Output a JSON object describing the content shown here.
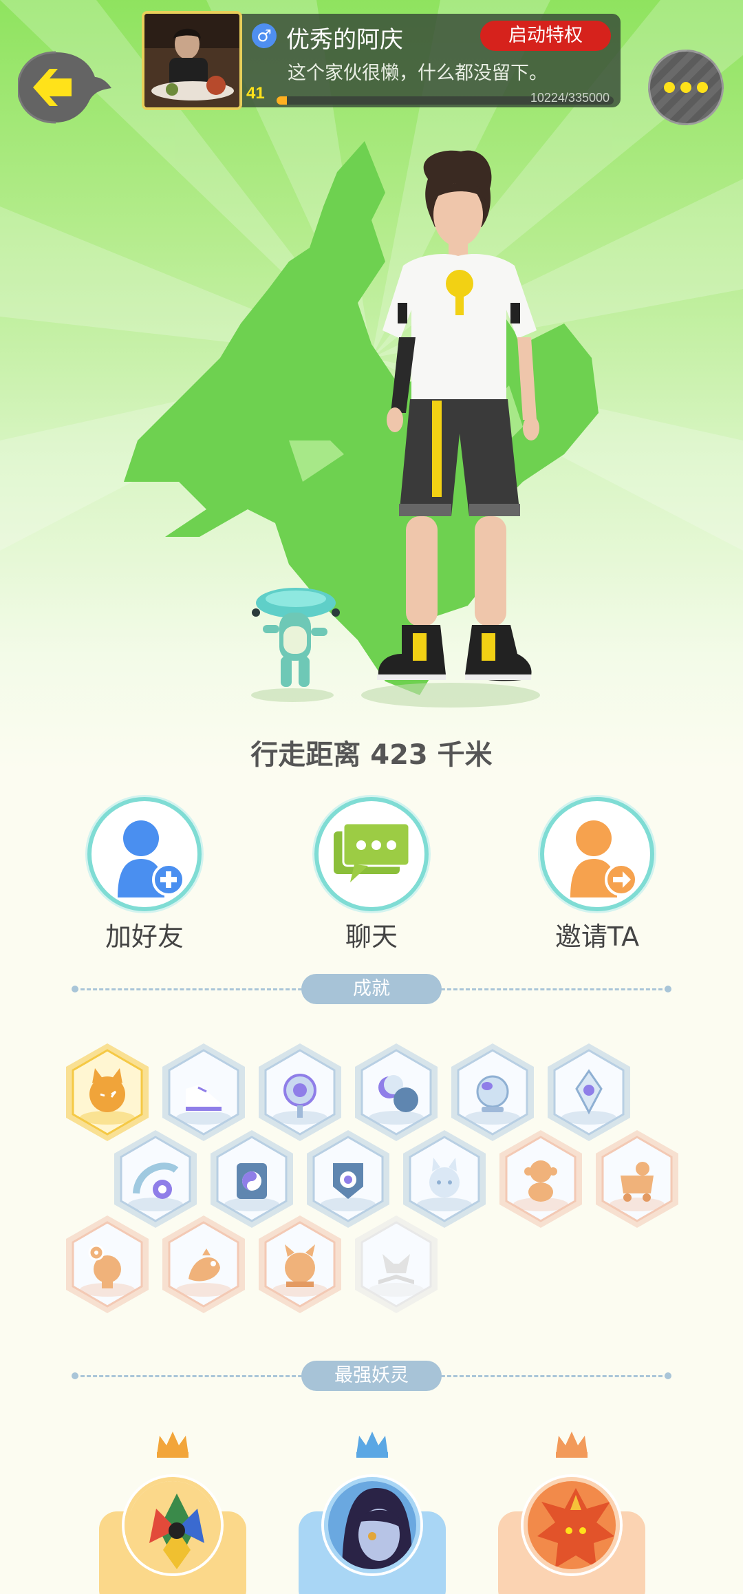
{
  "header": {
    "username": "优秀的阿庆",
    "gender_symbol": "♂",
    "vip_button_label": "启动特权",
    "signature": "这个家伙很懒，什么都没留下。",
    "level": "41",
    "exp_text": "10224/335000",
    "exp_progress": 0.0305
  },
  "stats": {
    "distance_text": "行走距离 423 千米"
  },
  "actions": {
    "add_friend": "加好友",
    "chat": "聊天",
    "invite": "邀请TA"
  },
  "sections": {
    "achievements": "成就",
    "strongest_spirits": "最强妖灵"
  },
  "achievements": [
    {
      "icon": "fox-face-icon",
      "color": "#f5c945",
      "unlocked": true
    },
    {
      "icon": "sneaker-icon",
      "color": "#b8cfe3",
      "unlocked": false
    },
    {
      "icon": "pin-ring-icon",
      "color": "#b8cfe3",
      "unlocked": false
    },
    {
      "icon": "moon-phase-icon",
      "color": "#b8cfe3",
      "unlocked": false
    },
    {
      "icon": "crystal-ball-icon",
      "color": "#b8cfe3",
      "unlocked": false
    },
    {
      "icon": "crystal-icon",
      "color": "#b8cfe3",
      "unlocked": false
    },
    {
      "icon": "yin-yang-wave-icon",
      "color": "#b8cfe3",
      "unlocked": false
    },
    {
      "icon": "yin-yang-scroll-icon",
      "color": "#b8cfe3",
      "unlocked": false
    },
    {
      "icon": "shield-eye-icon",
      "color": "#b8cfe3",
      "unlocked": false
    },
    {
      "icon": "spirit-cat-icon",
      "color": "#b8cfe3",
      "unlocked": false
    },
    {
      "icon": "monkey-icon",
      "color": "#f3c9b4",
      "unlocked": false
    },
    {
      "icon": "baby-carriage-icon",
      "color": "#f3c9b4",
      "unlocked": false
    },
    {
      "icon": "donut-cat-icon",
      "color": "#f3c9b4",
      "unlocked": false
    },
    {
      "icon": "koi-fish-icon",
      "color": "#f3c9b4",
      "unlocked": false
    },
    {
      "icon": "demon-icon",
      "color": "#f3c9b4",
      "unlocked": false
    },
    {
      "icon": "book-wolf-icon",
      "color": "#e8e8e8",
      "unlocked": false
    }
  ],
  "spirits": [
    {
      "icon": "crystal-beast-icon",
      "card_color": "#fbd88a",
      "crown_color": "#f2a53a"
    },
    {
      "icon": "dark-haired-girl-icon",
      "card_color": "#a9d6f5",
      "crown_color": "#5aa7e4"
    },
    {
      "icon": "fire-dragon-icon",
      "card_color": "#fbd3b2",
      "crown_color": "#f29a5a"
    }
  ]
}
